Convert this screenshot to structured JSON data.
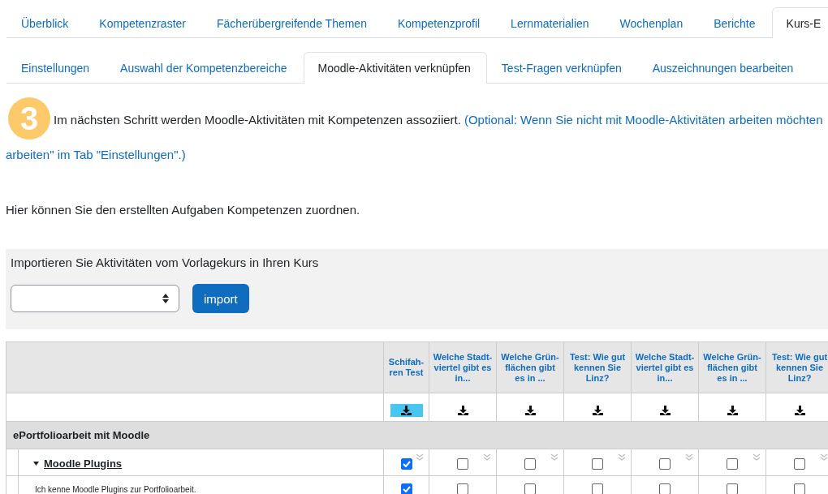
{
  "tabs": [
    {
      "label": "Überblick",
      "selected": false
    },
    {
      "label": "Kompetenzraster",
      "selected": false
    },
    {
      "label": "Fächerübergreifende Themen",
      "selected": false
    },
    {
      "label": "Kompetenzprofil",
      "selected": false
    },
    {
      "label": "Lernmaterialien",
      "selected": false
    },
    {
      "label": "Wochenplan",
      "selected": false
    },
    {
      "label": "Berichte",
      "selected": false
    },
    {
      "label": "Kurs-E",
      "selected": true
    }
  ],
  "subtabs": [
    {
      "label": "Einstellungen",
      "selected": false
    },
    {
      "label": "Auswahl der Kompetenzbereiche",
      "selected": false
    },
    {
      "label": "Moodle-Aktivitäten verknüpfen",
      "selected": true
    },
    {
      "label": "Test-Fragen verknüpfen",
      "selected": false
    },
    {
      "label": "Auszeichnungen bearbeiten",
      "selected": false
    }
  ],
  "step": {
    "number": "3",
    "text": "Im nächsten Schritt werden Moodle-Aktivitäten mit Kompetenzen assoziiert.",
    "hint_line_1": "(Optional: Wenn Sie nicht mit Moodle-Aktivitäten arbeiten möchten",
    "hint_line_2": "arbeiten\" im Tab \"Einstellungen\".)"
  },
  "intro": "Hier können Sie den erstellten Aufgaben Kompetenzen zuordnen.",
  "import": {
    "label": "Importieren Sie Aktivitäten vom Vorlagekurs in Ihren Kurs",
    "button": "import"
  },
  "table": {
    "columns": [
      {
        "title": "Schifah-ren Test",
        "highlighted": true
      },
      {
        "title": "Welche Stadt-viertel gibt es in...",
        "highlighted": false
      },
      {
        "title": "Welche Grün-flächen gibt es in ...",
        "highlighted": false
      },
      {
        "title": "Test: Wie gut kennen Sie Linz?",
        "highlighted": false
      },
      {
        "title": "Welche Stadt-viertel gibt es in...",
        "highlighted": false
      },
      {
        "title": "Welche Grün-flächen gibt es in ...",
        "highlighted": false
      },
      {
        "title": "Test: Wie gut kennen Sie Linz?",
        "highlighted": false
      }
    ],
    "section": "ePortfolioarbeit mit Moodle",
    "rows": [
      {
        "kind": "topic",
        "label": "Moodle Plugins",
        "checks": [
          {
            "checked": true
          },
          {
            "checked": false
          },
          {
            "checked": false
          },
          {
            "checked": false
          },
          {
            "checked": false
          },
          {
            "checked": false
          },
          {
            "checked": false
          }
        ]
      },
      {
        "kind": "item",
        "label": "Ich kenne Moodle Plugins zur Portfolioarbeit.",
        "checks": [
          {
            "checked": true
          },
          {
            "checked": false
          },
          {
            "checked": false
          },
          {
            "checked": false
          },
          {
            "checked": false
          },
          {
            "checked": false
          },
          {
            "checked": false
          }
        ]
      }
    ]
  }
}
